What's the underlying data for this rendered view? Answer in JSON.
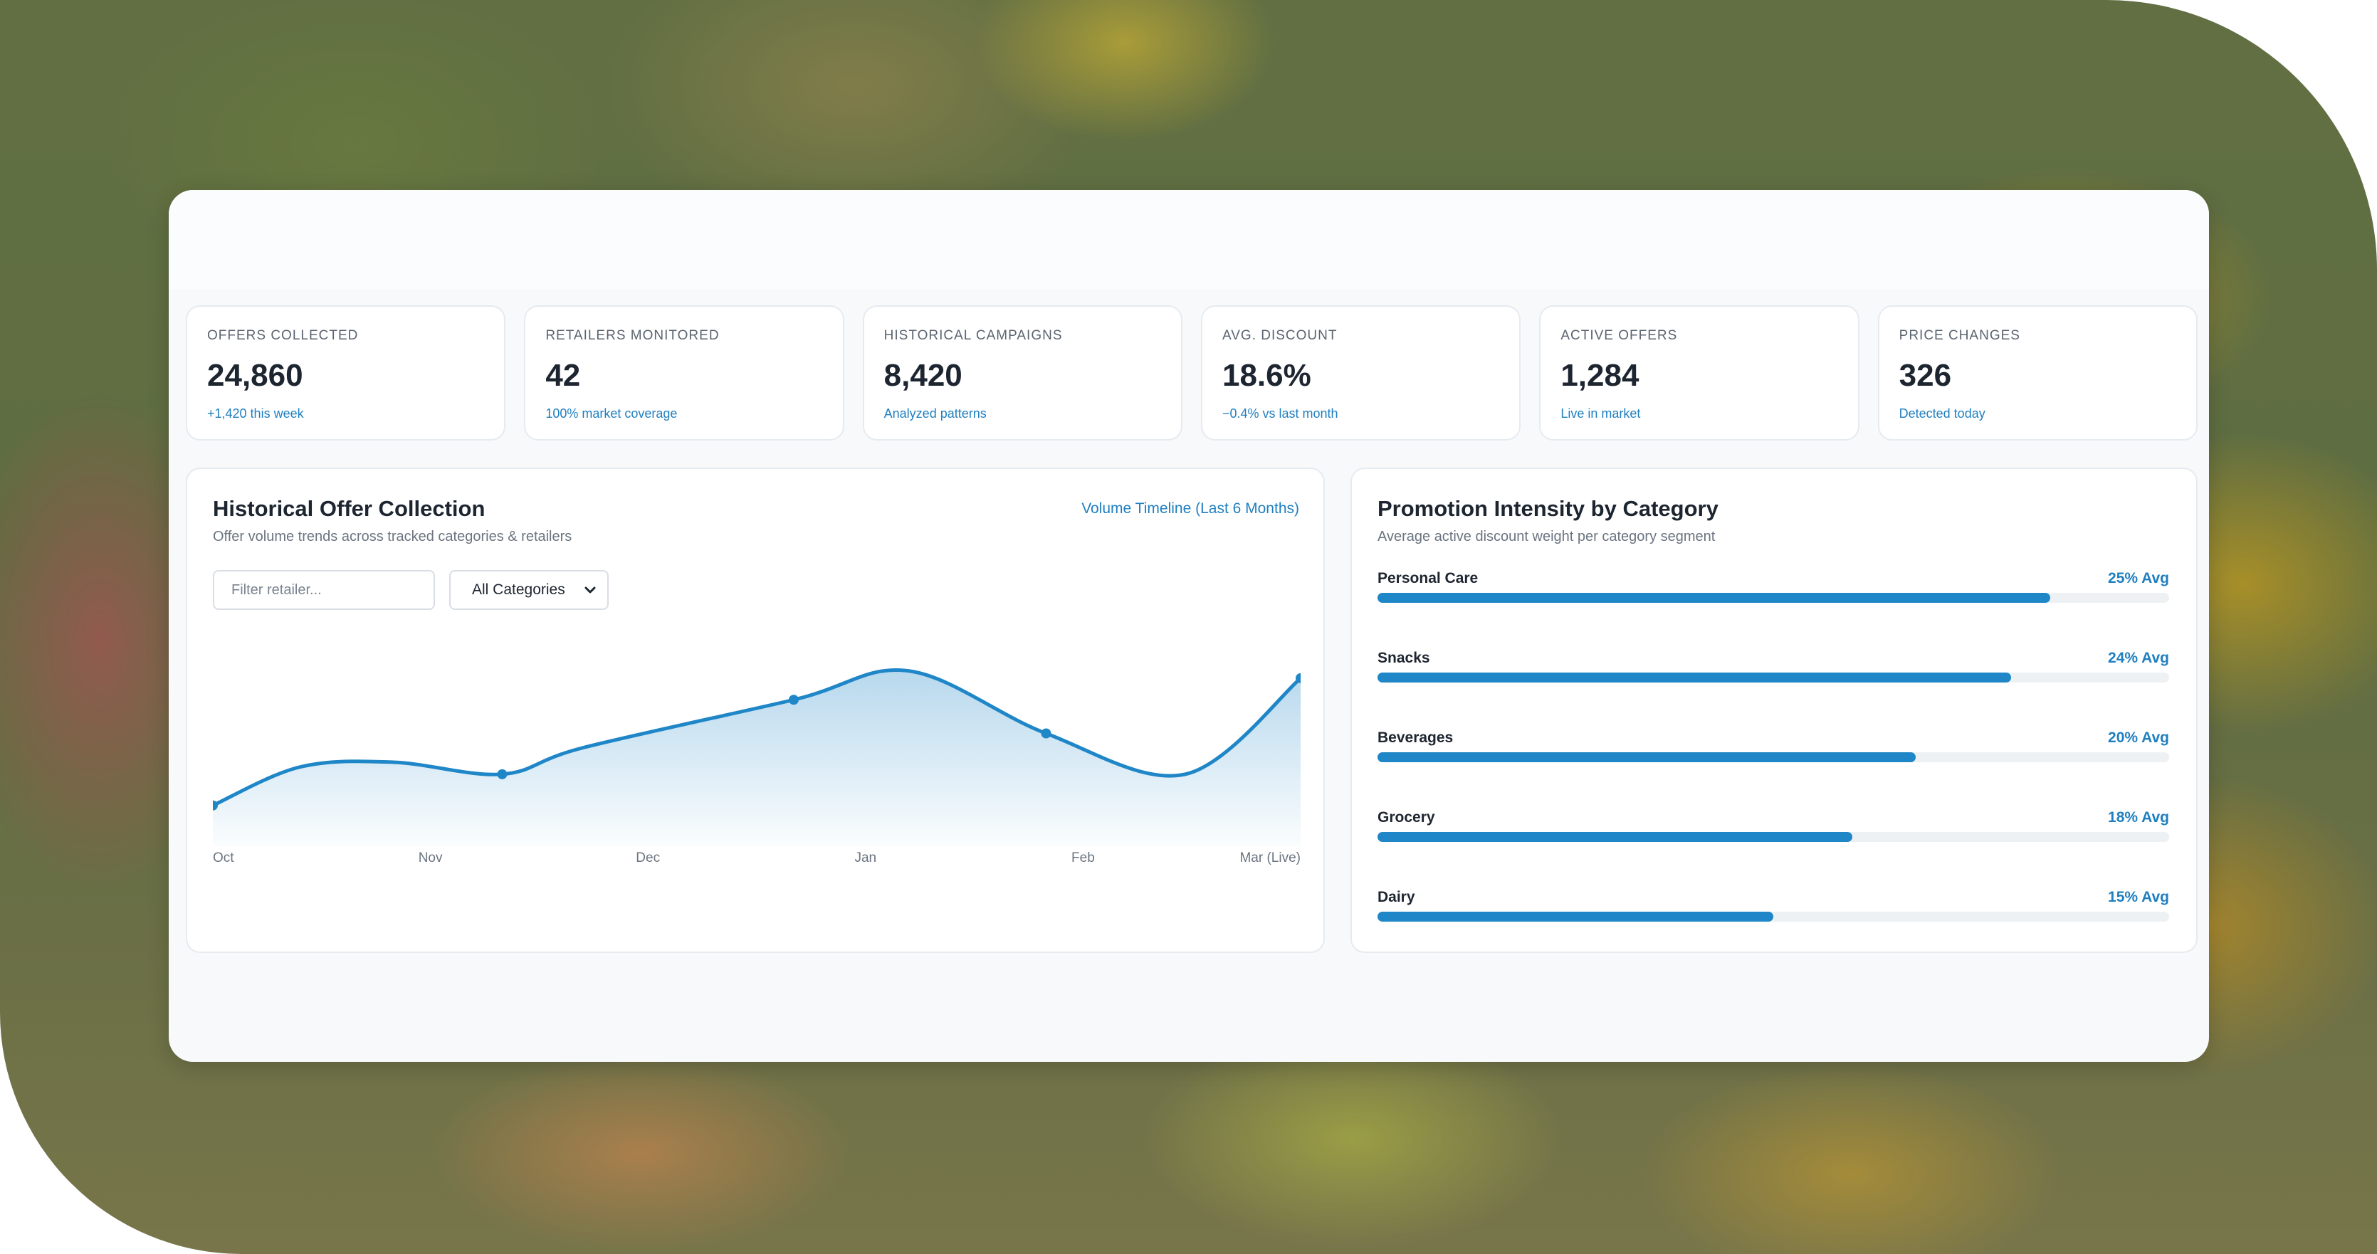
{
  "kpis": [
    {
      "label": "OFFERS COLLECTED",
      "value": "24,860",
      "sub": "+1,420 this week"
    },
    {
      "label": "RETAILERS MONITORED",
      "value": "42",
      "sub": "100% market coverage"
    },
    {
      "label": "HISTORICAL CAMPAIGNS",
      "value": "8,420",
      "sub": "Analyzed patterns"
    },
    {
      "label": "AVG. DISCOUNT",
      "value": "18.6%",
      "sub": "−0.4% vs last month"
    },
    {
      "label": "ACTIVE OFFERS",
      "value": "1,284",
      "sub": "Live in market"
    },
    {
      "label": "PRICE CHANGES",
      "value": "326",
      "sub": "Detected today"
    }
  ],
  "history": {
    "title": "Historical Offer Collection",
    "subtitle": "Offer volume trends across tracked categories & retailers",
    "timeline_link": "Volume Timeline (Last 6 Months)",
    "filter_placeholder": "Filter retailer...",
    "category_select": "All Categories"
  },
  "promotion": {
    "title": "Promotion Intensity by Category",
    "subtitle": "Average active discount weight per category segment",
    "categories": [
      {
        "name": "Personal Care",
        "avg": "25% Avg",
        "fill": 0.85
      },
      {
        "name": "Snacks",
        "avg": "24% Avg",
        "fill": 0.8
      },
      {
        "name": "Beverages",
        "avg": "20% Avg",
        "fill": 0.68
      },
      {
        "name": "Grocery",
        "avg": "18% Avg",
        "fill": 0.6
      },
      {
        "name": "Dairy",
        "avg": "15% Avg",
        "fill": 0.5
      }
    ]
  },
  "colors": {
    "accent": "#1f86c7",
    "accent_text": "#1f7fc0",
    "track": "#eef1f4"
  },
  "chart_data": {
    "type": "area",
    "categories": [
      "Oct",
      "Nov",
      "Dec",
      "Jan",
      "Feb",
      "Mar (Live)"
    ],
    "x": [
      0,
      1,
      2,
      3,
      4,
      5
    ],
    "series": [
      {
        "x": [
          0,
          0.4,
          0.83,
          1.33,
          1.7,
          2.67,
          3.2,
          3.83,
          4.47,
          5.0
        ],
        "values": [
          14,
          30,
          32,
          27,
          38,
          58,
          70,
          44,
          27,
          67
        ]
      }
    ],
    "ylim": [
      0,
      80
    ],
    "grid": false,
    "markers_at": [
      0,
      1.33,
      2.67,
      3.83,
      5.0
    ]
  }
}
